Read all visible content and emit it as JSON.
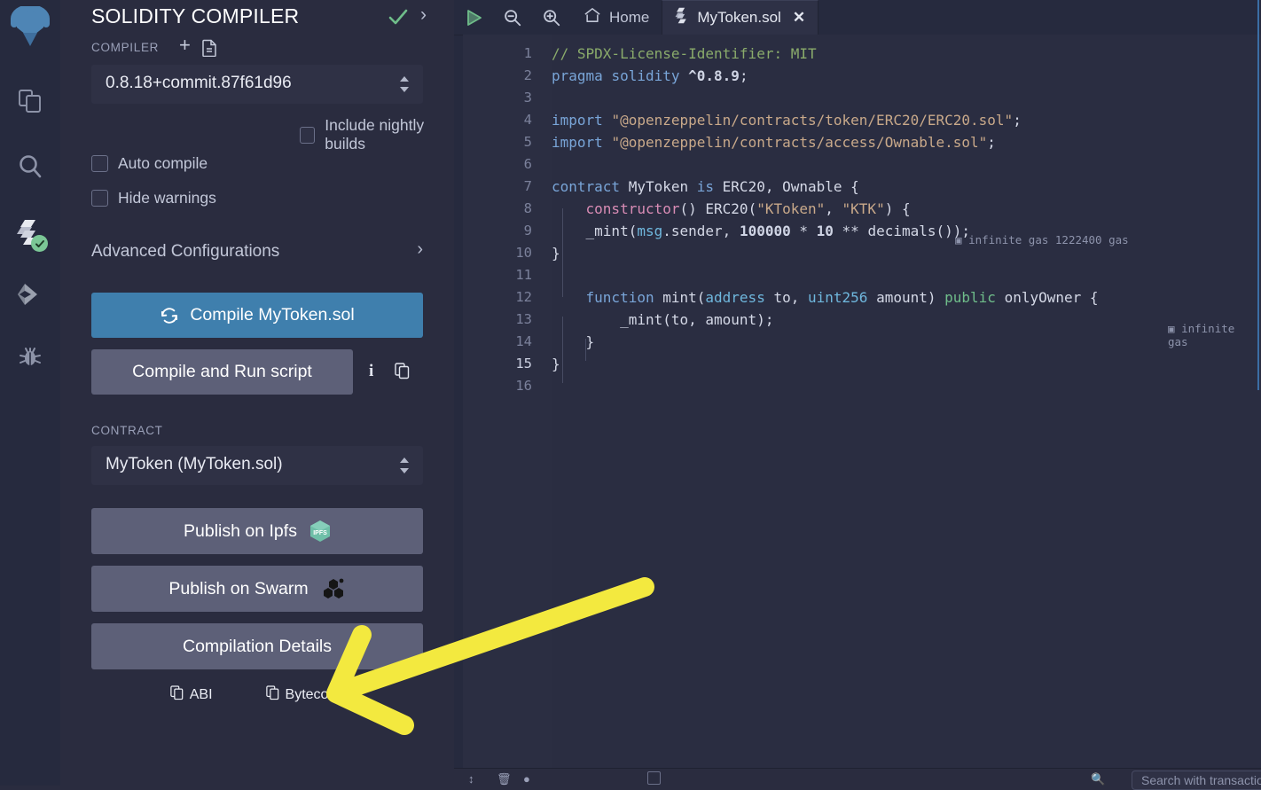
{
  "sidebar": {
    "items": [
      {
        "name": "remix-logo",
        "label": "Remix"
      },
      {
        "name": "file-explorer",
        "label": "File explorer"
      },
      {
        "name": "search",
        "label": "Search in files"
      },
      {
        "name": "solidity-compiler",
        "label": "Solidity compiler"
      },
      {
        "name": "deploy-run",
        "label": "Deploy & run transactions"
      },
      {
        "name": "debugger",
        "label": "Debugger"
      }
    ]
  },
  "panel": {
    "title": "SOLIDITY COMPILER",
    "status_icon": "check-icon",
    "expand_icon": "chevron-right-icon",
    "compiler_label": "COMPILER",
    "add_icon": "plus-icon",
    "doc_icon": "document-icon",
    "version": "0.8.18+commit.87f61d96",
    "checkboxes": [
      {
        "label": "Include nightly builds",
        "checked": false
      },
      {
        "label": "Auto compile",
        "checked": false
      },
      {
        "label": "Hide warnings",
        "checked": false
      }
    ],
    "advanced": "Advanced Configurations",
    "compile_button": "Compile MyToken.sol",
    "compile_icon": "refresh-icon",
    "run_script_button": "Compile and Run script",
    "info_icon": "info-icon",
    "copy_icon": "copy-icon",
    "contract_label": "CONTRACT",
    "contract_value": "MyToken (MyToken.sol)",
    "publish_ipfs": "Publish on Ipfs",
    "ipfs_badge": "IPFS",
    "publish_swarm": "Publish on Swarm",
    "compilation_details": "Compilation Details",
    "abi_label": "ABI",
    "bytecode_label": "Bytecode"
  },
  "editor": {
    "run_icon": "play-icon",
    "zoom_out_icon": "zoom-out-icon",
    "zoom_in_icon": "zoom-in-icon",
    "home_icon": "home-icon",
    "home_tab": "Home",
    "file_icon": "solidity-icon",
    "active_tab": "MyToken.sol",
    "close_icon": "close-icon",
    "gas_icon": "gas-icon",
    "gas_constructor": "infinite gas 1222400 gas",
    "gas_mint": "infinite gas",
    "lines": [
      {
        "n": "1",
        "segs": [
          {
            "t": "// SPDX-License-Identifier: MIT",
            "c": "c-comment"
          }
        ]
      },
      {
        "n": "2",
        "segs": [
          {
            "t": "pragma",
            "c": "c-key"
          },
          {
            "t": " ",
            "c": "c-plain"
          },
          {
            "t": "solidity",
            "c": "c-id"
          },
          {
            "t": " ",
            "c": "c-plain"
          },
          {
            "t": "^0.8.9",
            "c": "c-num"
          },
          {
            "t": ";",
            "c": "c-plain"
          }
        ]
      },
      {
        "n": "3",
        "segs": []
      },
      {
        "n": "4",
        "segs": [
          {
            "t": "import",
            "c": "c-key"
          },
          {
            "t": " ",
            "c": "c-plain"
          },
          {
            "t": "\"@openzeppelin/contracts/token/ERC20/ERC20.sol\"",
            "c": "c-str"
          },
          {
            "t": ";",
            "c": "c-plain"
          }
        ]
      },
      {
        "n": "5",
        "segs": [
          {
            "t": "import",
            "c": "c-key"
          },
          {
            "t": " ",
            "c": "c-plain"
          },
          {
            "t": "\"@openzeppelin/contracts/access/Ownable.sol\"",
            "c": "c-str"
          },
          {
            "t": ";",
            "c": "c-plain"
          }
        ]
      },
      {
        "n": "6",
        "segs": []
      },
      {
        "n": "7",
        "segs": [
          {
            "t": "contract",
            "c": "c-key"
          },
          {
            "t": " MyToken ",
            "c": "c-plain"
          },
          {
            "t": "is",
            "c": "c-key"
          },
          {
            "t": " ERC20, Ownable {",
            "c": "c-plain"
          }
        ]
      },
      {
        "n": "8",
        "segs": [
          {
            "t": "    ",
            "c": "c-plain"
          },
          {
            "t": "constructor",
            "c": "c-fn"
          },
          {
            "t": "() ERC20(",
            "c": "c-plain"
          },
          {
            "t": "\"KToken\"",
            "c": "c-str"
          },
          {
            "t": ", ",
            "c": "c-plain"
          },
          {
            "t": "\"KTK\"",
            "c": "c-str"
          },
          {
            "t": ") {",
            "c": "c-plain"
          }
        ]
      },
      {
        "n": "9",
        "segs": [
          {
            "t": "    _mint(",
            "c": "c-plain"
          },
          {
            "t": "msg",
            "c": "c-type"
          },
          {
            "t": ".sender, ",
            "c": "c-plain"
          },
          {
            "t": "100000",
            "c": "c-num"
          },
          {
            "t": " * ",
            "c": "c-plain"
          },
          {
            "t": "10",
            "c": "c-num"
          },
          {
            "t": " ** decimals());",
            "c": "c-plain"
          }
        ]
      },
      {
        "n": "10",
        "segs": [
          {
            "t": "}",
            "c": "c-plain"
          }
        ]
      },
      {
        "n": "11",
        "segs": []
      },
      {
        "n": "12",
        "segs": [
          {
            "t": "    ",
            "c": "c-plain"
          },
          {
            "t": "function",
            "c": "c-key"
          },
          {
            "t": " mint(",
            "c": "c-plain"
          },
          {
            "t": "address",
            "c": "c-type"
          },
          {
            "t": " to, ",
            "c": "c-plain"
          },
          {
            "t": "uint256",
            "c": "c-type"
          },
          {
            "t": " amount) ",
            "c": "c-plain"
          },
          {
            "t": "public",
            "c": "c-mod"
          },
          {
            "t": " onlyOwner {",
            "c": "c-plain"
          }
        ]
      },
      {
        "n": "13",
        "segs": [
          {
            "t": "        _mint(to, amount);",
            "c": "c-plain"
          }
        ]
      },
      {
        "n": "14",
        "segs": [
          {
            "t": "    }",
            "c": "c-plain"
          }
        ]
      },
      {
        "n": "15",
        "segs": [
          {
            "t": "}",
            "c": "c-plain"
          }
        ]
      },
      {
        "n": "16",
        "segs": []
      }
    ]
  },
  "terminal": {
    "search_placeholder": "Search with transaction hash or address"
  },
  "annotation": {
    "shape": "arrow",
    "color": "#f3e93f",
    "points_to": "ABI"
  },
  "colors": {
    "accent_blue": "#3f7fad",
    "button_gray": "#5d6078",
    "panel_bg": "#2a2c3f",
    "editor_bg": "#262a3e",
    "success_green": "#7bc796",
    "annotation_yellow": "#f3e93f"
  }
}
